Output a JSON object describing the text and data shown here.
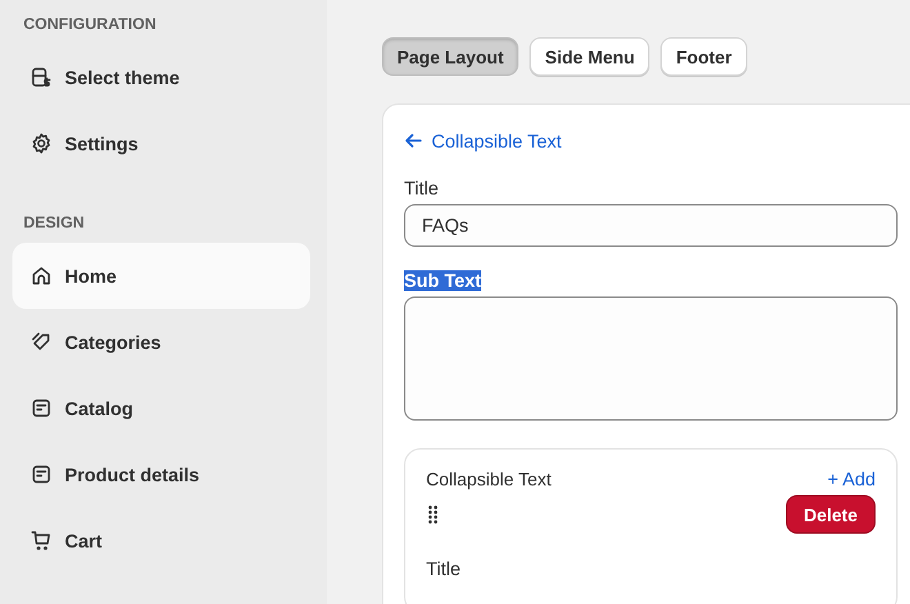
{
  "sidebar": {
    "sections": [
      {
        "heading": "CONFIGURATION",
        "items": [
          {
            "label": "Select theme",
            "selected": false
          },
          {
            "label": "Settings",
            "selected": false
          }
        ]
      },
      {
        "heading": "DESIGN",
        "items": [
          {
            "label": "Home",
            "selected": true
          },
          {
            "label": "Categories",
            "selected": false
          },
          {
            "label": "Catalog",
            "selected": false
          },
          {
            "label": "Product details",
            "selected": false
          },
          {
            "label": "Cart",
            "selected": false
          }
        ]
      }
    ]
  },
  "tabs": [
    {
      "label": "Page Layout",
      "selected": true
    },
    {
      "label": "Side Menu",
      "selected": false
    },
    {
      "label": "Footer",
      "selected": false
    }
  ],
  "editor": {
    "back_link": "Collapsible Text",
    "fields": [
      {
        "label": "Title",
        "value": "FAQs",
        "kind": "input",
        "highlighted": false
      },
      {
        "label": "Sub Text",
        "kind": "textarea",
        "highlighted": true
      }
    ],
    "block": {
      "title": "Collapsible Text",
      "add_link": "+ Add",
      "delete_button": "Delete",
      "next_label": "Title"
    }
  }
}
